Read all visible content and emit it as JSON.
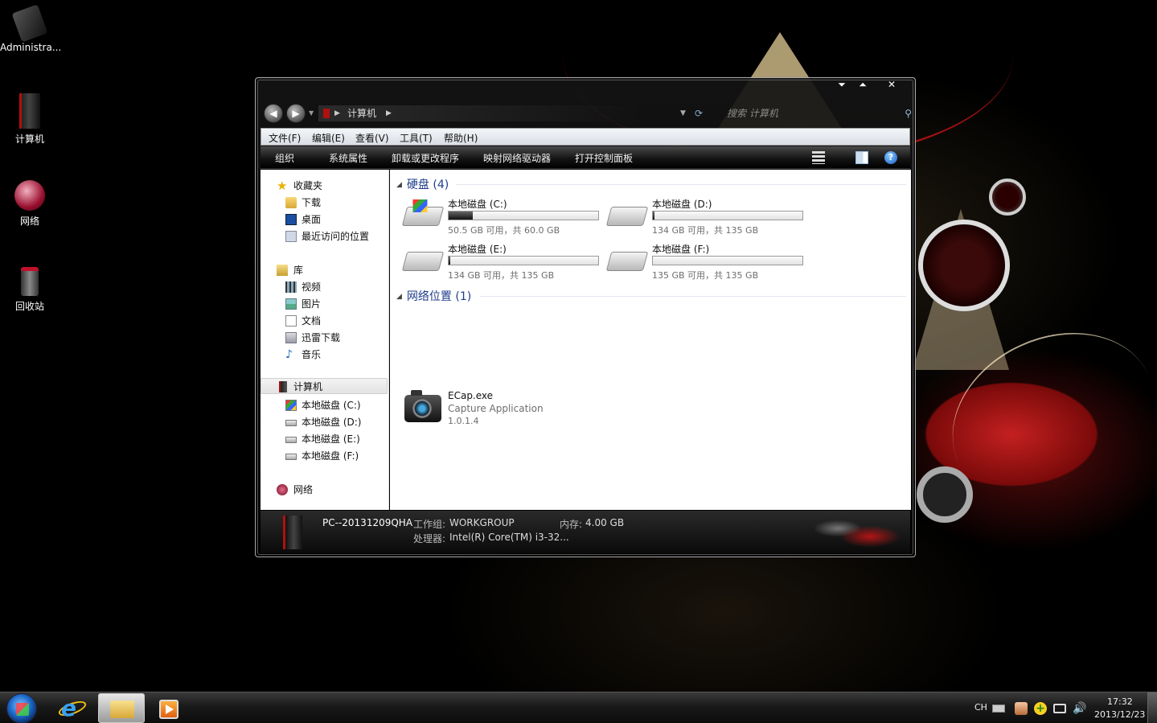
{
  "desktop": {
    "icons": [
      {
        "label": "Administra..."
      },
      {
        "label": "计算机"
      },
      {
        "label": "网络"
      },
      {
        "label": "回收站"
      }
    ]
  },
  "window": {
    "caption_buttons": {
      "minimize": "⏷",
      "maximize": "⏶",
      "close": "✕"
    },
    "nav": {
      "back": "◀",
      "forward": "▶"
    },
    "address": {
      "location": "计算机"
    },
    "search": {
      "placeholder": "搜索 计算机"
    },
    "menu": [
      "文件(F)",
      "编辑(E)",
      "查看(V)",
      "工具(T)",
      "帮助(H)"
    ],
    "toolbar": [
      "组织",
      "系统属性",
      "卸载或更改程序",
      "映射网络驱动器",
      "打开控制面板"
    ],
    "toolbar_help": "?",
    "nav_pane": {
      "favorites": {
        "label": "收藏夹",
        "items": [
          "下载",
          "桌面",
          "最近访问的位置"
        ]
      },
      "libraries": {
        "label": "库",
        "items": [
          "视频",
          "图片",
          "文档",
          "迅雷下载",
          "音乐"
        ]
      },
      "computer": {
        "label": "计算机",
        "items": [
          "本地磁盘 (C:)",
          "本地磁盘 (D:)",
          "本地磁盘 (E:)",
          "本地磁盘 (F:)"
        ]
      },
      "network": {
        "label": "网络"
      }
    },
    "content": {
      "hard_disks": {
        "heading": "硬盘 (4)",
        "drives": [
          {
            "name": "本地磁盘 (C:)",
            "free_text": "50.5 GB 可用，共 60.0 GB",
            "used_fraction": 0.16,
            "system": true
          },
          {
            "name": "本地磁盘 (D:)",
            "free_text": "134 GB 可用，共 135 GB",
            "used_fraction": 0.01,
            "system": false
          },
          {
            "name": "本地磁盘 (E:)",
            "free_text": "134 GB 可用，共 135 GB",
            "used_fraction": 0.01,
            "system": false
          },
          {
            "name": "本地磁盘 (F:)",
            "free_text": "135 GB 可用，共 135 GB",
            "used_fraction": 0.0,
            "system": false
          }
        ]
      },
      "network_locations": {
        "heading": "网络位置 (1)",
        "items": [
          {
            "name": "ECap.exe",
            "description": "Capture Application",
            "version": "1.0.1.4"
          }
        ]
      }
    },
    "details": {
      "computer_name": "PC--20131209QHA",
      "workgroup_label": "工作组:",
      "workgroup": "WORKGROUP",
      "memory_label": "内存:",
      "memory": "4.00 GB",
      "processor_label": "处理器:",
      "processor": "Intel(R) Core(TM) i3-32..."
    }
  },
  "taskbar": {
    "tray": {
      "language": "CH",
      "time": "17:32",
      "date": "2013/12/23"
    }
  },
  "colors": {
    "group_heading": "#1e3e8a",
    "accent_red": "#b01010"
  }
}
